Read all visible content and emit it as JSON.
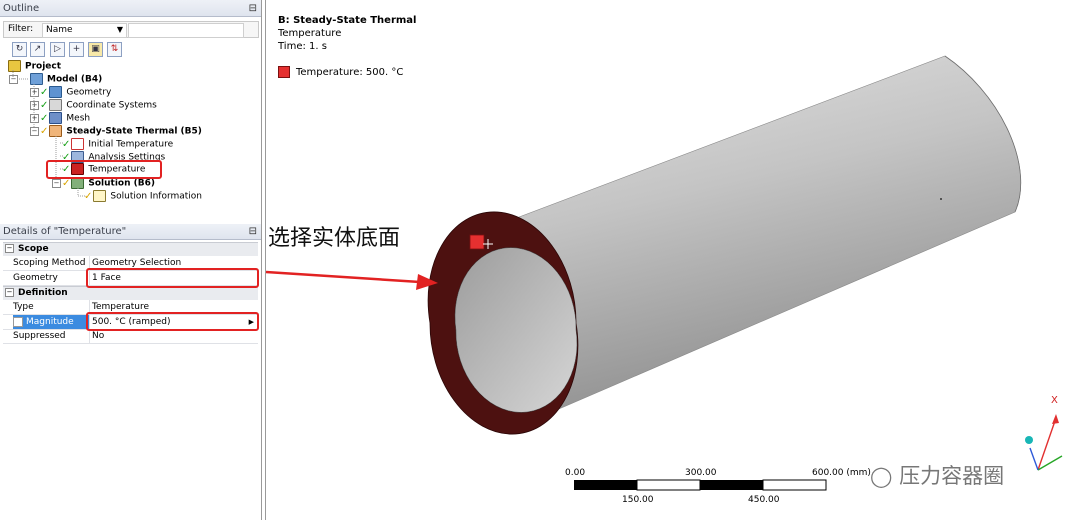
{
  "outline": {
    "title": "Outline",
    "filter_label": "Filter:",
    "filter_value": "Name",
    "tree": [
      {
        "label": "Project"
      },
      {
        "label": "Model (B4)"
      },
      {
        "label": "Geometry"
      },
      {
        "label": "Coordinate Systems"
      },
      {
        "label": "Mesh"
      },
      {
        "label": "Steady-State Thermal (B5)"
      },
      {
        "label": "Initial Temperature"
      },
      {
        "label": "Analysis Settings"
      },
      {
        "label": "Temperature"
      },
      {
        "label": "Solution (B6)"
      },
      {
        "label": "Solution Information"
      }
    ]
  },
  "details": {
    "title": "Details of \"Temperature\"",
    "sections": [
      {
        "name": "Scope",
        "rows": [
          {
            "key": "Scoping Method",
            "value": "Geometry Selection"
          },
          {
            "key": "Geometry",
            "value": "1 Face"
          }
        ]
      },
      {
        "name": "Definition",
        "rows": [
          {
            "key": "Type",
            "value": "Temperature"
          },
          {
            "key": "Magnitude",
            "value": "500. °C  (ramped)"
          },
          {
            "key": "Suppressed",
            "value": "No"
          }
        ]
      }
    ]
  },
  "viewport": {
    "analysis_title": "B: Steady-State Thermal",
    "result_type": "Temperature",
    "time": "Time: 1. s",
    "legend_label": "Temperature: 500. °C",
    "annotation": "选择实体底面",
    "scale": {
      "top_labels": [
        "0.00",
        "300.00",
        "600.00 (mm)"
      ],
      "bottom_labels": [
        "150.00",
        "450.00"
      ]
    },
    "triad": {
      "x_label": "X"
    }
  },
  "watermark": "压力容器圈",
  "colors": {
    "selected_face": "#4d1110",
    "cylinder": "#bdbdbd",
    "highlight": "#e22222",
    "legend": "#e53030",
    "selection_blue": "#3b8be0"
  }
}
